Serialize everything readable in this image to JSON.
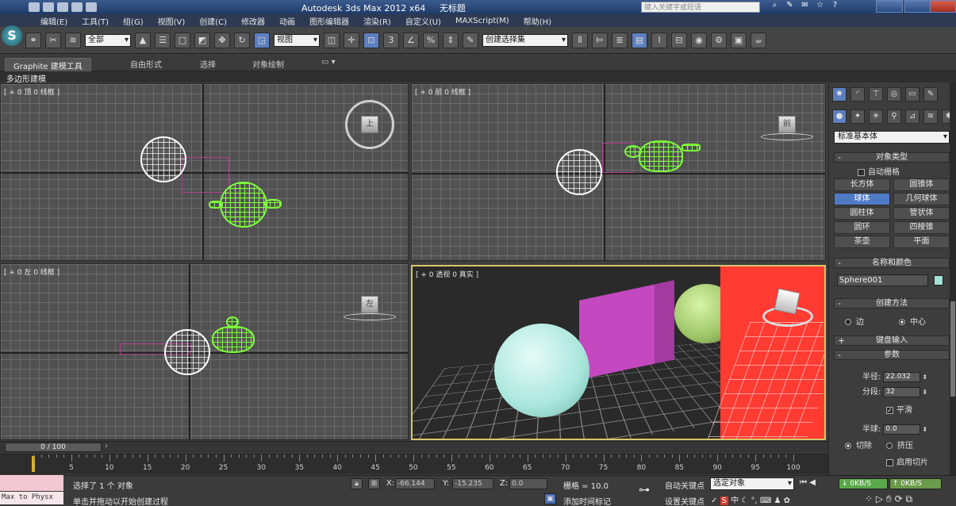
{
  "titlebar": {
    "app_title": "Autodesk 3ds Max  2012 x64",
    "doc_title": "无标题",
    "search_placeholder": "键入关键字或短语"
  },
  "menu": [
    "编辑(E)",
    "工具(T)",
    "组(G)",
    "视图(V)",
    "创建(C)",
    "修改器",
    "动画",
    "图形编辑器",
    "渲染(R)",
    "自定义(U)",
    "MAXScript(M)",
    "帮助(H)"
  ],
  "toolbar": {
    "filter_combo": "全部",
    "coord_combo": "视图",
    "snap_labels": [
      "3",
      "%"
    ],
    "selset_combo": "创建选择集"
  },
  "ribbon": {
    "tabs": [
      "Graphite 建模工具",
      "自由形式",
      "选择",
      "对象绘制"
    ],
    "sub_label": "多边形建模"
  },
  "viewports": {
    "top": "[ + 0 顶 0 线框 ]",
    "front": "[ + 0 前 0 线框 ]",
    "left": "[ + 0 左 0 线框 ]",
    "persp": "[ + 0 透视 0 真实 ]",
    "cube_top": "上",
    "cube_front": "前",
    "cube_left": "左"
  },
  "command_panel": {
    "category_combo": "标准基本体",
    "rollout_object_type": "对象类型",
    "autogrid": "自动栅格",
    "object_buttons": [
      "长方体",
      "圆锥体",
      "球体",
      "几何球体",
      "圆柱体",
      "管状体",
      "圆环",
      "四棱锥",
      "茶壶",
      "平面"
    ],
    "selected_button": "球体",
    "rollout_name_color": "名称和颜色",
    "object_name": "Sphere001",
    "rollout_creation_method": "创建方法",
    "method_edge": "边",
    "method_center": "中心",
    "rollout_keyboard": "键盘输入",
    "rollout_params": "参数",
    "radius_label": "半径:",
    "radius_value": "22.032",
    "segments_label": "分段:",
    "segments_value": "32",
    "smooth_label": "平滑",
    "hemisphere_label": "半球:",
    "hemisphere_value": "0.0",
    "chop_label": "切除",
    "squash_label": "挤压",
    "slice_label": "启用切片"
  },
  "timeline": {
    "frame_display": "0 / 100",
    "ticks": [
      "5",
      "10",
      "15",
      "20",
      "25",
      "30",
      "35",
      "40",
      "45",
      "50",
      "55",
      "60",
      "65",
      "70",
      "75",
      "80",
      "85",
      "90",
      "95",
      "100"
    ]
  },
  "status": {
    "selected": "选择了 1 个 对象",
    "prompt": "单击并拖动以开始创建过程",
    "x_label": "X:",
    "x_value": "-66.144",
    "y_label": "Y:",
    "y_value": "-15.235",
    "z_label": "Z:",
    "z_value": "0.0",
    "grid_label": "栅格 = 10.0",
    "add_time_tag": "添加时间标记",
    "autokey": "自动关键点",
    "autokey_combo": "选定对象",
    "setkey": "设置关键点",
    "up_speed": "0KB/S",
    "down_speed": "0KB/S",
    "physx": "Max to Physx"
  }
}
